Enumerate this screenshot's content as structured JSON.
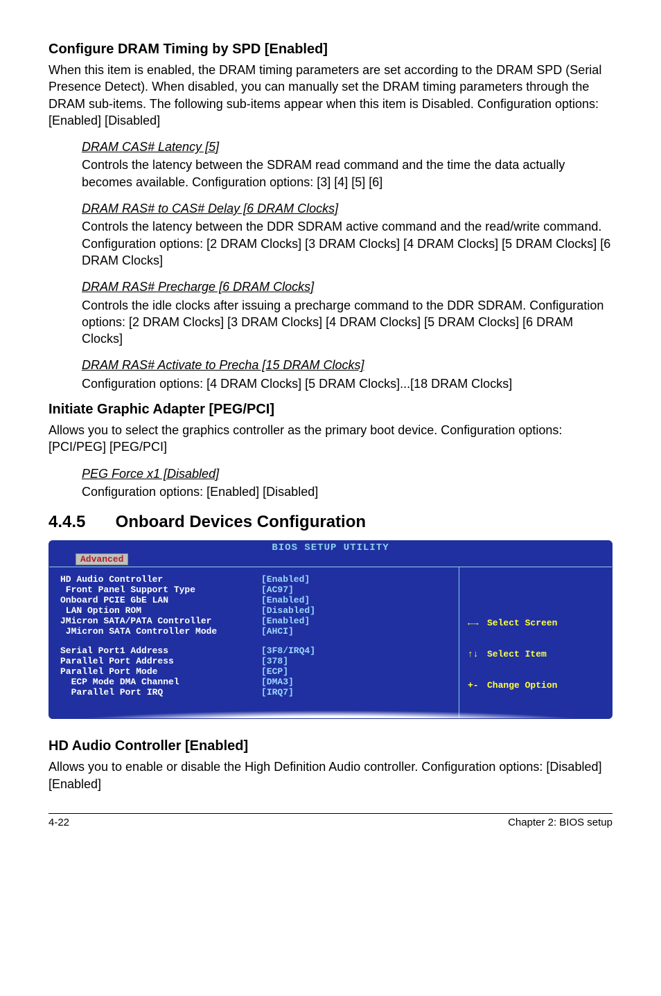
{
  "s1": {
    "title": "Configure DRAM Timing by SPD [Enabled]",
    "body": "When this item is enabled, the DRAM timing parameters are set according to the DRAM SPD (Serial Presence Detect). When disabled, you can manually set the DRAM timing parameters through the DRAM sub-items. The following sub-items appear when this item is Disabled. Configuration options: [Enabled] [Disabled]",
    "sub1_t": "DRAM CAS# Latency [5]",
    "sub1_b": "Controls the latency between the SDRAM read command and the time the data actually becomes available. Configuration options: [3] [4] [5] [6]",
    "sub2_t": "DRAM RAS#  to CAS# Delay [6 DRAM Clocks]",
    "sub2_b": "Controls the latency between the DDR SDRAM active command and the read/write command. Configuration options: [2 DRAM Clocks] [3 DRAM Clocks] [4 DRAM Clocks] [5 DRAM Clocks] [6 DRAM Clocks]",
    "sub3_t": "DRAM RAS# Precharge [6 DRAM Clocks]",
    "sub3_b": "Controls the idle clocks after issuing a precharge command to the DDR SDRAM. Configuration options: [2 DRAM Clocks] [3 DRAM Clocks] [4 DRAM Clocks] [5 DRAM Clocks] [6 DRAM Clocks]",
    "sub4_t": "DRAM RAS# Activate to Precha [15 DRAM Clocks]",
    "sub4_b": "Configuration options: [4 DRAM Clocks] [5 DRAM Clocks]...[18 DRAM Clocks]"
  },
  "s2": {
    "title": "Initiate Graphic Adapter [PEG/PCI]",
    "body": "Allows you to select the graphics controller as the primary boot device. Configuration options: [PCI/PEG] [PEG/PCI]",
    "sub1_t": "PEG Force x1 [Disabled]",
    "sub1_b": "Configuration options: [Enabled] [Disabled]"
  },
  "section": {
    "num": "4.4.5",
    "title": "Onboard Devices Configuration"
  },
  "bios": {
    "header": "BIOS SETUP UTILITY",
    "tab": "Advanced",
    "rows": [
      {
        "k": "HD Audio Controller",
        "v": "[Enabled]"
      },
      {
        "k": " Front Panel Support Type",
        "v": "[AC97]"
      },
      {
        "k": "Onboard PCIE GbE LAN",
        "v": "[Enabled]"
      },
      {
        "k": " LAN Option ROM",
        "v": "[Disabled]"
      },
      {
        "k": "JMicron SATA/PATA Controller",
        "v": "[Enabled]"
      },
      {
        "k": " JMicron SATA Controller Mode",
        "v": "[AHCI]"
      }
    ],
    "rows2": [
      {
        "k": "Serial Port1 Address",
        "v": "[3F8/IRQ4]"
      },
      {
        "k": "Parallel Port Address",
        "v": "[378]"
      },
      {
        "k": "Parallel Port Mode",
        "v": "[ECP]"
      },
      {
        "k": "  ECP Mode DMA Channel",
        "v": "[DMA3]"
      },
      {
        "k": "  Parallel Port IRQ",
        "v": "[IRQ7]"
      }
    ],
    "help": [
      {
        "sym": "←→",
        "txt": "Select Screen"
      },
      {
        "sym": "↑↓",
        "txt": "Select Item"
      },
      {
        "sym": "+-",
        "txt": "Change Option"
      }
    ]
  },
  "s3": {
    "title": "HD Audio Controller [Enabled]",
    "body": "Allows you to enable or disable the High Definition Audio controller. Configuration options: [Disabled] [Enabled]"
  },
  "footer": {
    "left": "4-22",
    "right": "Chapter 2: BIOS setup"
  }
}
